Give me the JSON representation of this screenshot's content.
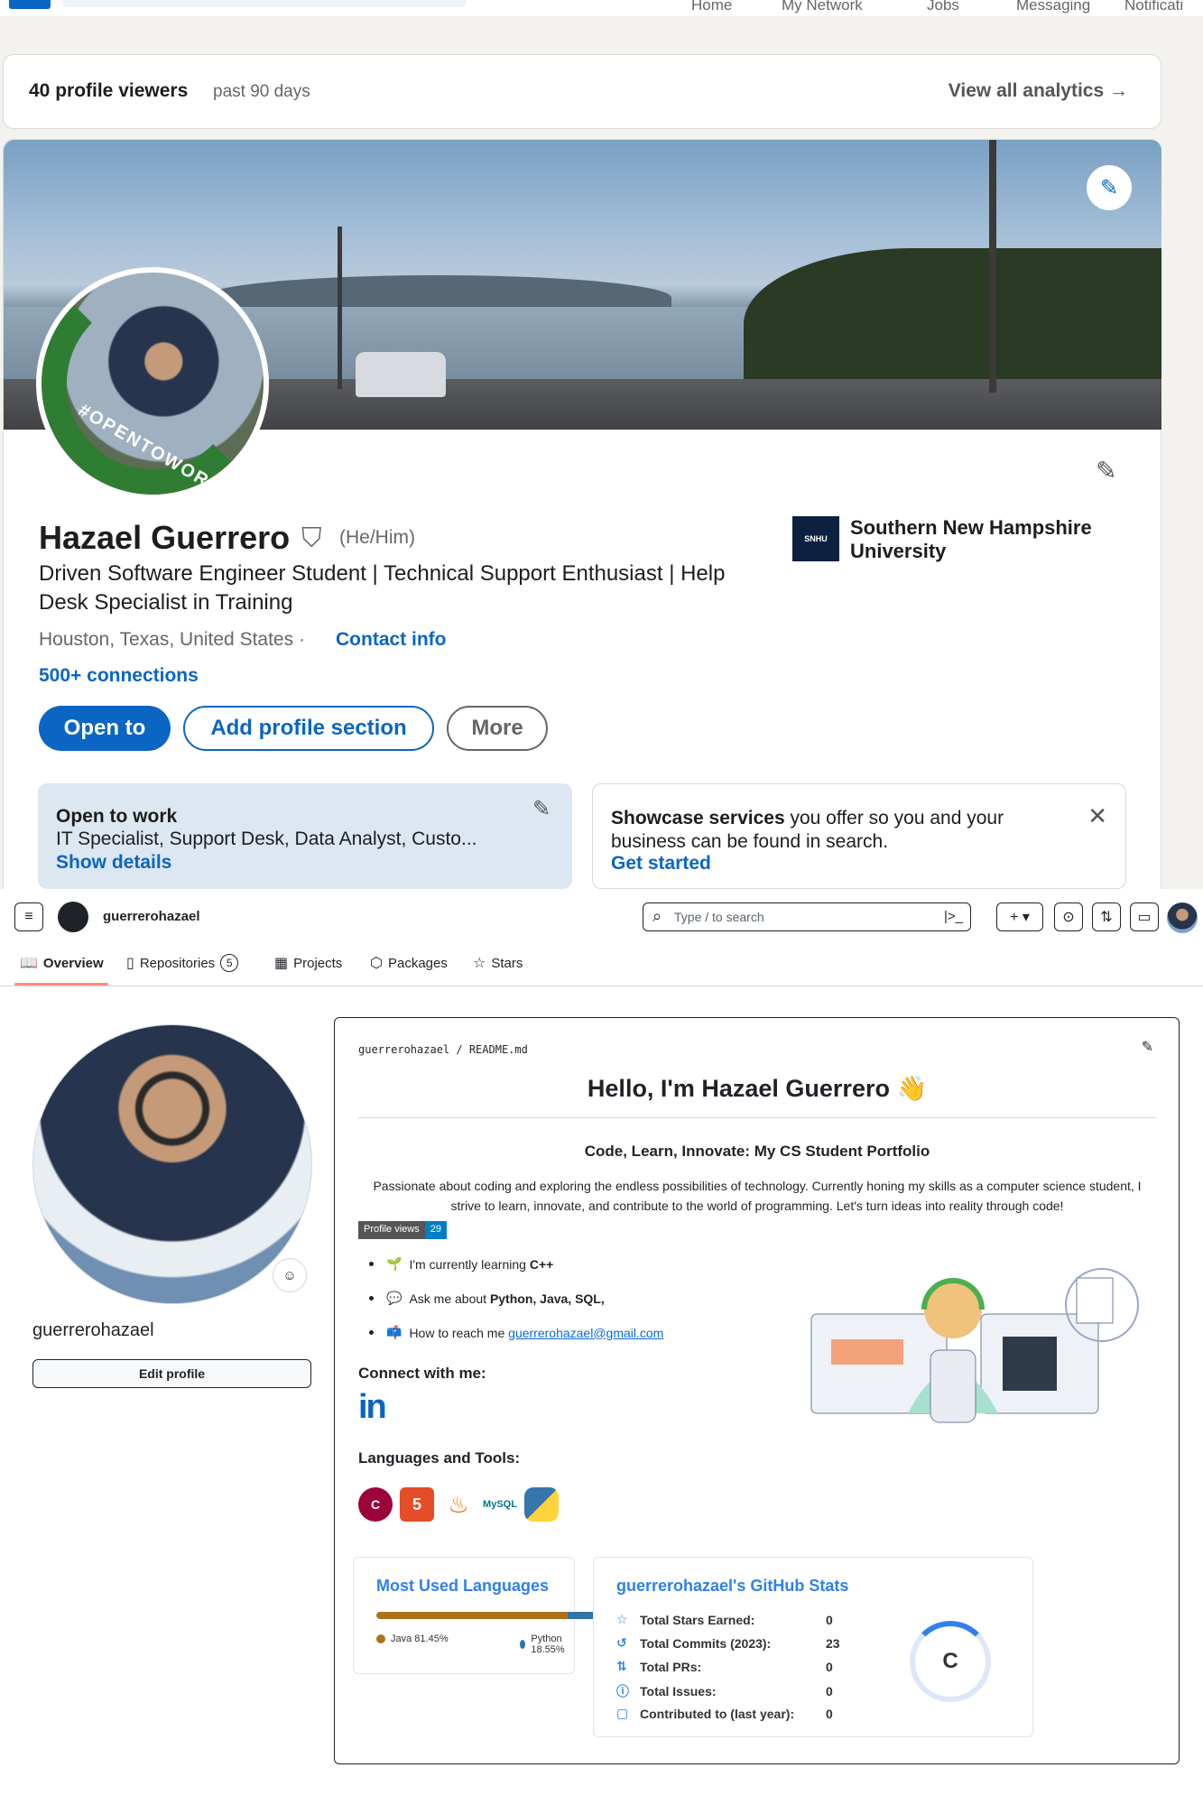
{
  "linkedin": {
    "nav": [
      "Home",
      "My Network",
      "Jobs",
      "Messaging",
      "Notificati"
    ],
    "viewers": {
      "title": "40 profile viewers",
      "period": "past 90 days",
      "link": "View all analytics →"
    },
    "profile": {
      "name": "Hazael Guerrero",
      "pronouns": "(He/Him)",
      "headline": "Driven Software Engineer Student | Technical Support Enthusiast | Help Desk Specialist in Training",
      "location": "Houston, Texas, United States ·",
      "contact": "Contact info",
      "connections": "500+ connections",
      "buttons": {
        "open_to": "Open to",
        "add_section": "Add profile section",
        "more": "More"
      },
      "school": "Southern New Hampshire University",
      "school_logo": "SNHU",
      "opentowork_ring": "#OPENTOWORK"
    },
    "open_to_work": {
      "title": "Open to work",
      "body": "IT Specialist, Support Desk, Data Analyst, Custo...",
      "link": "Show details"
    },
    "services": {
      "bold": "Showcase services",
      "rest": " you offer so you and your business can be found in search.",
      "link": "Get started"
    }
  },
  "github": {
    "username": "guerrerohazael",
    "search_placeholder": "Type / to search",
    "tabs": [
      {
        "label": "Overview"
      },
      {
        "label": "Repositories",
        "count": "5"
      },
      {
        "label": "Projects"
      },
      {
        "label": "Packages"
      },
      {
        "label": "Stars"
      }
    ],
    "edit_profile": "Edit profile",
    "readme": {
      "path": "guerrerohazael / README.md",
      "h1": "Hello, I'm Hazael Guerrero 👋",
      "h3": "Code, Learn, Innovate: My CS Student Portfolio",
      "intro": "Passionate about coding and exploring the endless possibilities of technology. Currently honing my skills as a computer science student, I strive to learn, innovate, and contribute to the world of programming. Let's turn ideas into reality through code!",
      "badge": {
        "label": "Profile views",
        "value": "29"
      },
      "bullets": [
        {
          "icon": "🌱",
          "text": "I'm currently learning ",
          "bold": "C++"
        },
        {
          "icon": "💬",
          "text": "Ask me about ",
          "bold": "Python, Java, SQL,"
        },
        {
          "icon": "📫",
          "text": "How to reach me ",
          "link": "guerrerohazael@gmail.com"
        }
      ],
      "connect_title": "Connect with me:",
      "linkedin_icon": "in",
      "langs_title": "Languages and Tools:",
      "tools": [
        "C++",
        "HTML5",
        "Java",
        "MySQL",
        "Python"
      ]
    },
    "most_used": {
      "title": "Most Used Languages",
      "langs": [
        {
          "name": "Java 81.45%",
          "pct": 81.45,
          "color": "#b07219"
        },
        {
          "name": "Python 18.55%",
          "pct": 18.55,
          "color": "#3572A5"
        }
      ]
    },
    "stats": {
      "title": "guerrerohazael's GitHub Stats",
      "rows": [
        {
          "icon": "☆",
          "label": "Total Stars Earned:",
          "value": "0"
        },
        {
          "icon": "↺",
          "label": "Total Commits (2023):",
          "value": "23"
        },
        {
          "icon": "⇅",
          "label": "Total PRs:",
          "value": "0"
        },
        {
          "icon": "ⓘ",
          "label": "Total Issues:",
          "value": "0"
        },
        {
          "icon": "▢",
          "label": "Contributed to (last year):",
          "value": "0"
        }
      ],
      "rank": "C"
    }
  }
}
